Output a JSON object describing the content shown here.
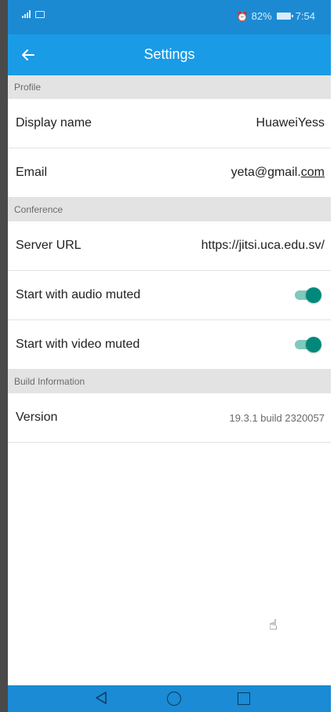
{
  "status_bar": {
    "battery_percent": "82%",
    "time": "7:54",
    "icons": [
      "signal-icon",
      "message-icon",
      "alarm-icon",
      "battery-icon"
    ]
  },
  "app_bar": {
    "title": "Settings",
    "back_icon": "arrow-left-icon"
  },
  "sections": {
    "profile": {
      "header": "Profile",
      "display_name_label": "Display name",
      "display_name_value": "HuaweiYess",
      "email_label": "Email",
      "email_user": "yeta@gmail.",
      "email_tld": "com"
    },
    "conference": {
      "header": "Conference",
      "server_url_label": "Server URL",
      "server_url_value": "https://jitsi.uca.edu.sv/",
      "audio_muted_label": "Start with audio muted",
      "audio_muted_on": true,
      "video_muted_label": "Start with video muted",
      "video_muted_on": true
    },
    "build_info": {
      "header": "Build Information",
      "version_label": "Version",
      "version_value": "19.3.1 build 2320057"
    }
  },
  "nav_bar": {
    "icons": [
      "nav-back-icon",
      "nav-home-icon",
      "nav-recents-icon"
    ]
  },
  "colors": {
    "status_bar": "#1c8ad3",
    "app_bar": "#1a9be6",
    "section_header": "#e3e3e3",
    "toggle_on": "#00897b",
    "nav_bar": "#1a8bd4"
  }
}
